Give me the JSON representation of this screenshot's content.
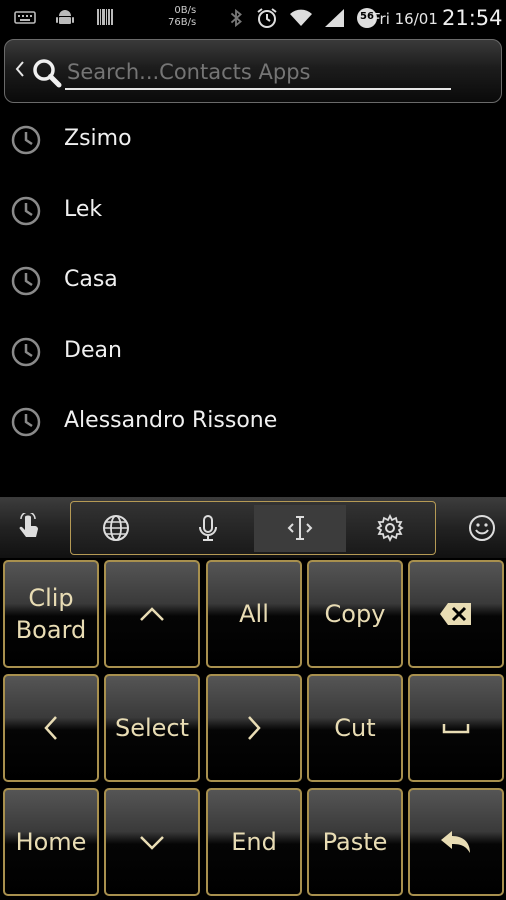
{
  "status_bar": {
    "net_up": "0B/s",
    "net_down": "76B/s",
    "date": "Fri 16/01",
    "time": "21:54",
    "battery_level": "56",
    "icons": [
      "keyboard-icon",
      "android-icon",
      "barcode-icon",
      "bluetooth-icon",
      "alarm-icon",
      "wifi-icon",
      "signal-icon",
      "battery-icon"
    ]
  },
  "search": {
    "placeholder": "Search...Contacts Apps",
    "value": ""
  },
  "contacts": [
    {
      "name": "Zsimo"
    },
    {
      "name": "Lek"
    },
    {
      "name": "Casa"
    },
    {
      "name": "Dean"
    },
    {
      "name": "Alessandro Rissone"
    }
  ],
  "keyboard": {
    "accent_color": "#a8904e",
    "text_color": "#e8dcb4",
    "toolbar_icons": [
      "hand-pointer-icon",
      "globe-icon",
      "microphone-icon",
      "text-cursor-icon",
      "gear-icon",
      "smiley-icon"
    ],
    "keys": {
      "clipboard_line1": "Clip",
      "clipboard_line2": "Board",
      "all": "All",
      "copy": "Copy",
      "select": "Select",
      "cut": "Cut",
      "home": "Home",
      "end": "End",
      "paste": "Paste"
    }
  }
}
